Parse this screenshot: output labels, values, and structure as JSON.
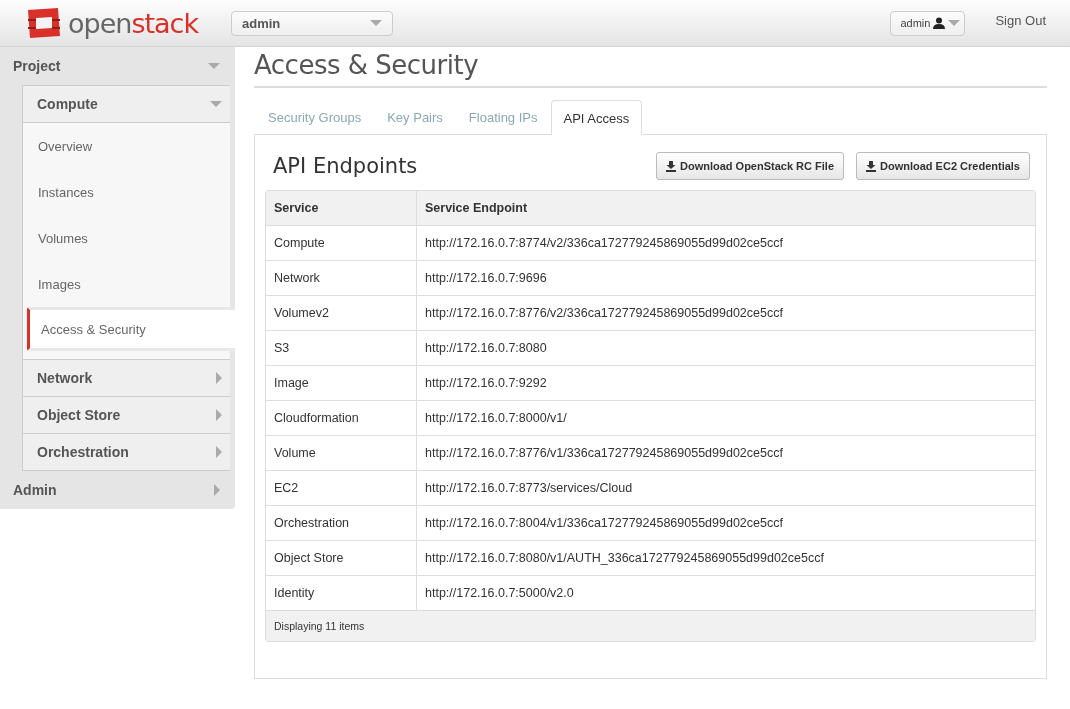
{
  "header": {
    "logo": {
      "part_1": "open",
      "part_2": "stack"
    },
    "project_selector": {
      "value": "admin"
    },
    "user_menu": {
      "label": "admin"
    },
    "sign_out": "Sign Out"
  },
  "sidebar": {
    "panels": [
      {
        "label": "Project",
        "expanded": true,
        "groups": [
          {
            "label": "Compute",
            "expanded": true,
            "items": [
              {
                "label": "Overview",
                "selected": false
              },
              {
                "label": "Instances",
                "selected": false
              },
              {
                "label": "Volumes",
                "selected": false
              },
              {
                "label": "Images",
                "selected": false
              },
              {
                "label": "Access & Security",
                "selected": true
              }
            ]
          },
          {
            "label": "Network",
            "expanded": false
          },
          {
            "label": "Object Store",
            "expanded": false
          },
          {
            "label": "Orchestration",
            "expanded": false
          }
        ]
      },
      {
        "label": "Admin",
        "expanded": false
      }
    ]
  },
  "page": {
    "title": "Access & Security",
    "tabs": [
      {
        "label": "Security Groups",
        "selected": false
      },
      {
        "label": "Key Pairs",
        "selected": false
      },
      {
        "label": "Floating IPs",
        "selected": false
      },
      {
        "label": "API Access",
        "selected": true
      }
    ],
    "section_title": "API Endpoints",
    "buttons": [
      "Download OpenStack RC File",
      "Download EC2 Credentials"
    ],
    "table": {
      "columns": [
        "Service",
        "Service Endpoint"
      ],
      "rows": [
        [
          "Compute",
          "http://172.16.0.7:8774/v2/336ca172779245869055d99d02ce5ccf"
        ],
        [
          "Network",
          "http://172.16.0.7:9696"
        ],
        [
          "Volumev2",
          "http://172.16.0.7:8776/v2/336ca172779245869055d99d02ce5ccf"
        ],
        [
          "S3",
          "http://172.16.0.7:8080"
        ],
        [
          "Image",
          "http://172.16.0.7:9292"
        ],
        [
          "Cloudformation",
          "http://172.16.0.7:8000/v1/"
        ],
        [
          "Volume",
          "http://172.16.0.7:8776/v1/336ca172779245869055d99d02ce5ccf"
        ],
        [
          "EC2",
          "http://172.16.0.7:8773/services/Cloud"
        ],
        [
          "Orchestration",
          "http://172.16.0.7:8004/v1/336ca172779245869055d99d02ce5ccf"
        ],
        [
          "Object Store",
          "http://172.16.0.7:8080/v1/AUTH_336ca172779245869055d99d02ce5ccf"
        ],
        [
          "Identity",
          "http://172.16.0.7:5000/v2.0"
        ]
      ],
      "footer": "Displaying 11 items"
    }
  }
}
